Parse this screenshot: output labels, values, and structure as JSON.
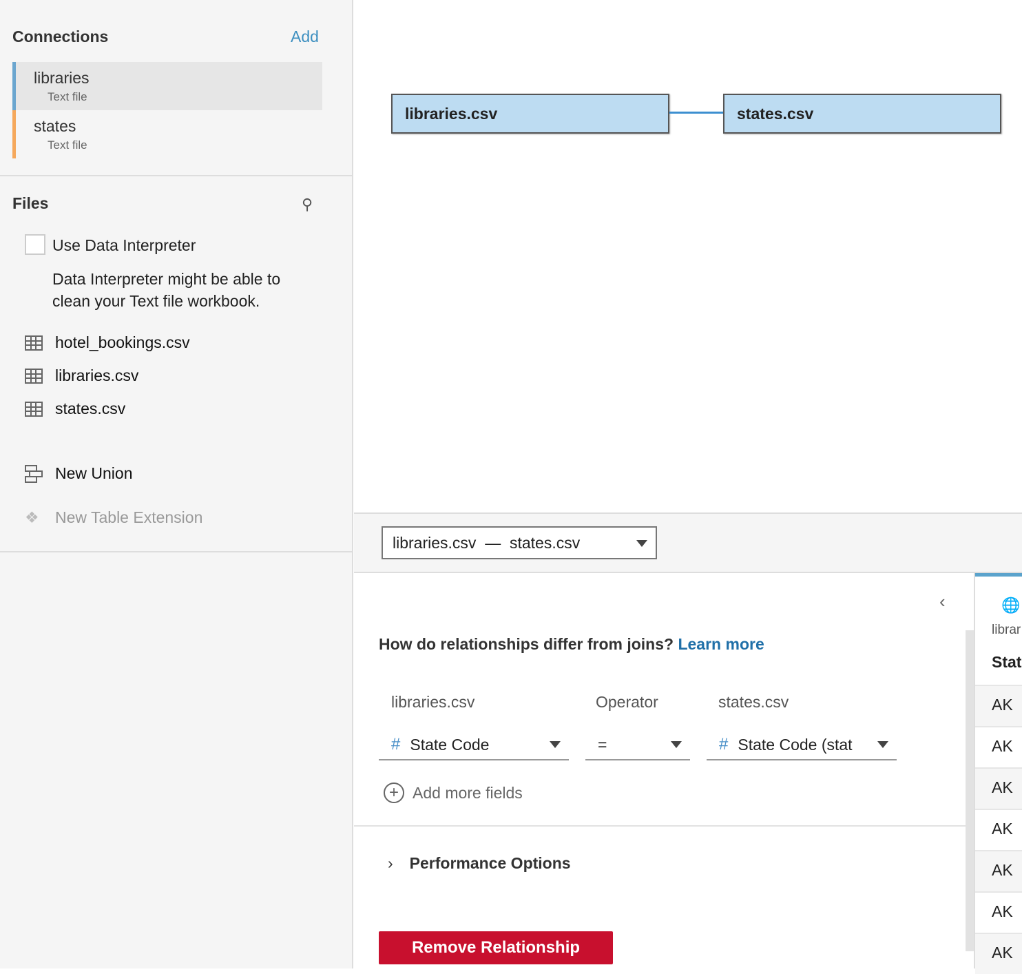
{
  "sidebar": {
    "connections_title": "Connections",
    "add_label": "Add",
    "connections": [
      {
        "name": "libraries",
        "type": "Text file",
        "color": "#6ba6cf"
      },
      {
        "name": "states",
        "type": "Text file",
        "color": "#f5a85c"
      }
    ],
    "files_title": "Files",
    "interpreter_label": "Use Data Interpreter",
    "interpreter_desc": "Data Interpreter might be able to clean your Text file workbook.",
    "files": [
      "hotel_bookings.csv",
      "libraries.csv",
      "states.csv"
    ],
    "new_union": "New Union",
    "new_table_extension": "New Table Extension"
  },
  "canvas": {
    "left_table": "libraries.csv",
    "right_table": "states.csv"
  },
  "relationship": {
    "selector": {
      "left": "libraries.csv",
      "sep": "—",
      "right": "states.csv"
    },
    "question": "How do relationships differ from joins?",
    "learn_more": "Learn more",
    "col_left": "libraries.csv",
    "col_op": "Operator",
    "col_right": "states.csv",
    "left_field": "State Code",
    "operator": "=",
    "right_field": "State Code (stat",
    "add_more": "Add more fields",
    "performance": "Performance Options",
    "remove": "Remove Relationship"
  },
  "preview": {
    "source": "librar",
    "column": "Stat",
    "rows": [
      "AK",
      "AK",
      "AK",
      "AK",
      "AK",
      "AK",
      "AK"
    ]
  }
}
